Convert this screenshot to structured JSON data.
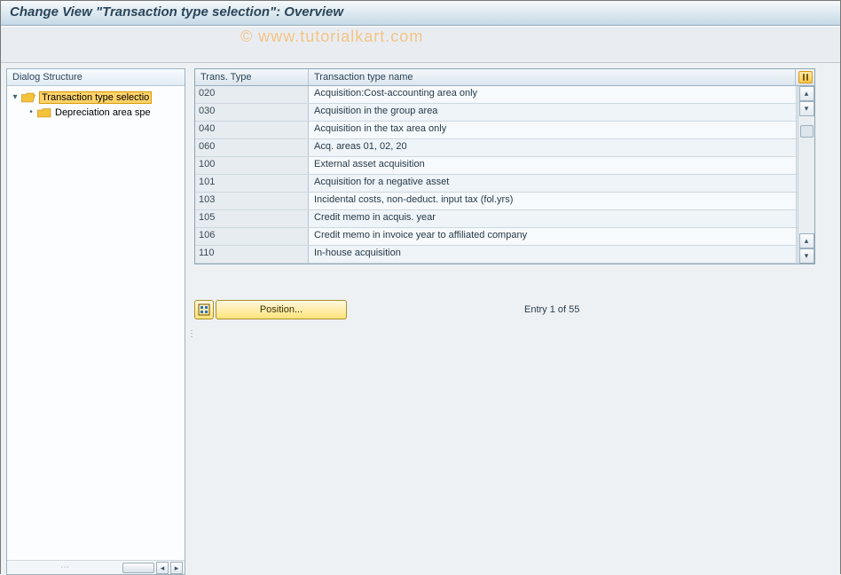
{
  "title": "Change View \"Transaction type selection\": Overview",
  "watermark": "© www.tutorialkart.com",
  "sidebar": {
    "header": "Dialog Structure",
    "items": [
      {
        "label": "Transaction type selectio",
        "selected": true,
        "open": true,
        "level": 0
      },
      {
        "label": "Depreciation area spe",
        "selected": false,
        "open": false,
        "level": 1
      }
    ]
  },
  "table": {
    "columns": {
      "c1": "Trans. Type",
      "c2": "Transaction type name"
    },
    "rows": [
      {
        "code": "020",
        "name": "Acquisition:Cost-accounting area only"
      },
      {
        "code": "030",
        "name": "Acquisition in the group area"
      },
      {
        "code": "040",
        "name": "Acquisition in the tax area only"
      },
      {
        "code": "060",
        "name": "Acq. areas 01, 02, 20"
      },
      {
        "code": "100",
        "name": "External asset acquisition"
      },
      {
        "code": "101",
        "name": "Acquisition for a negative asset"
      },
      {
        "code": "103",
        "name": "Incidental costs, non-deduct. input tax (fol.yrs)"
      },
      {
        "code": "105",
        "name": "Credit memo in acquis. year"
      },
      {
        "code": "106",
        "name": "Credit memo in invoice year to affiliated company"
      },
      {
        "code": "110",
        "name": "In-house acquisition"
      }
    ]
  },
  "footer": {
    "position_label": "Position...",
    "entry_info": "Entry 1 of 55"
  }
}
